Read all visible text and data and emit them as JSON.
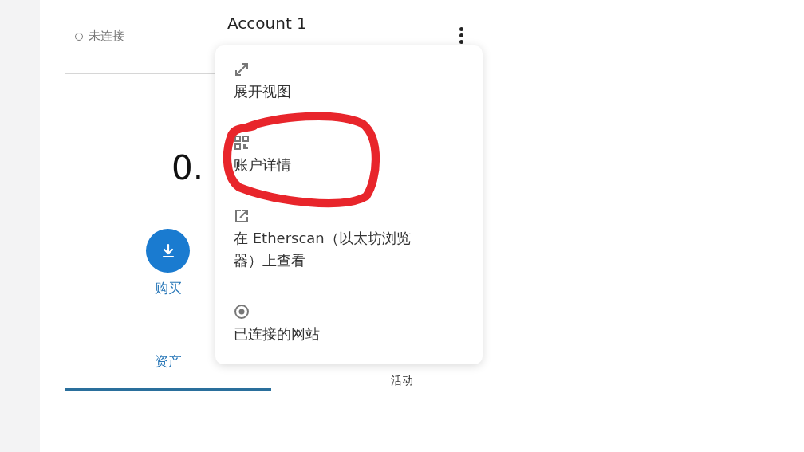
{
  "header": {
    "connection_status": "未连接",
    "connected": false,
    "account_name": "Account 1"
  },
  "balance": "0.",
  "actions": [
    {
      "label": "购买",
      "kind": "buy"
    }
  ],
  "tabs": [
    {
      "label": "资产",
      "selected": true
    },
    {
      "label": "活动",
      "selected": false
    }
  ],
  "menu": {
    "items": [
      {
        "label": "展开视图",
        "kind": "expand",
        "circled": false
      },
      {
        "label": "账户详情",
        "kind": "qr",
        "circled": true
      },
      {
        "label": "在 Etherscan（以太坊浏览器）上查看",
        "kind": "external",
        "circled": false
      },
      {
        "label": "已连接的网站",
        "kind": "connected",
        "circled": false
      }
    ]
  }
}
